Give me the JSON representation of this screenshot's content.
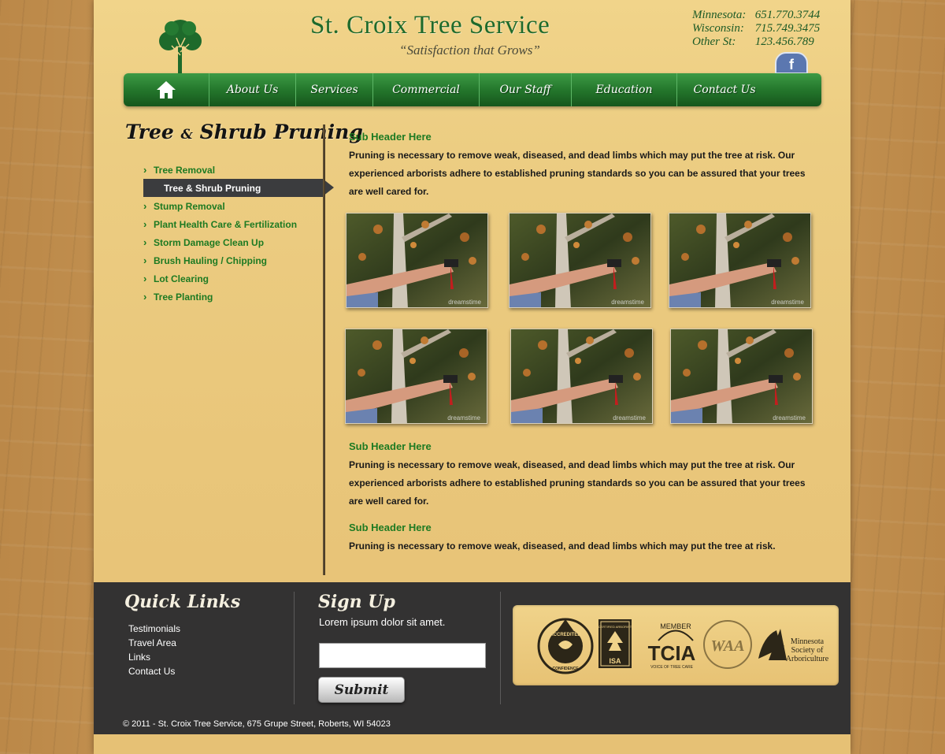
{
  "header": {
    "title": "St. Croix Tree Service",
    "tagline": "“Satisfaction that Grows”",
    "phones": [
      {
        "label": "Minnesota:",
        "number": "651.770.3744"
      },
      {
        "label": "Wisconsin:",
        "number": "715.749.3475"
      },
      {
        "label": "Other St:",
        "number": "123.456.789"
      }
    ]
  },
  "nav": {
    "items": [
      "About Us",
      "Services",
      "Commercial",
      "Our Staff",
      "Education",
      "Contact Us"
    ]
  },
  "sidebar": {
    "heading_a": "Tree",
    "heading_amp": "&",
    "heading_b": "Shrub Pruning",
    "items": [
      "Tree Removal",
      "Tree & Shrub Pruning",
      "Stump Removal",
      "Plant Health Care & Fertilization",
      "Storm Damage Clean Up",
      "Brush Hauling / Chipping",
      "Lot Clearing",
      "Tree Planting"
    ],
    "active_index": 1
  },
  "content": {
    "sections": [
      {
        "subheader": "Sub Header Here",
        "text": "Pruning is necessary to remove weak, diseased, and dead limbs which may put the tree at risk. Our experienced arborists adhere to established pruning standards so you can be assured that your trees are well cared for."
      },
      {
        "subheader": "Sub Header Here",
        "text": "Pruning is necessary to remove weak, diseased, and dead limbs which may put the tree at risk. Our experienced arborists adhere to established pruning standards so you can be assured that your trees are well cared for."
      },
      {
        "subheader": "Sub Header Here",
        "text": "Pruning is necessary to remove weak, diseased, and dead limbs which may put the tree at risk."
      }
    ],
    "watermark": "dreamstime"
  },
  "footer": {
    "quick_links_heading": "Quick Links",
    "quick_links": [
      "Testimonials",
      "Travel Area",
      "Links",
      "Contact Us"
    ],
    "signup_heading": "Sign Up",
    "signup_text": "Lorem ipsum dolor sit amet.",
    "signup_value": "",
    "submit_label": "Submit",
    "associations": {
      "accredited": "ACCREDITED",
      "accredited_bottom": "CONFIDENCE",
      "isa_top": "CERTIFIED ARBORIST",
      "isa": "ISA",
      "tcia_member": "MEMBER",
      "tcia": "TCIA",
      "tcia_sub": "VOICE OF TREE CARE",
      "waa": "WAA",
      "mn_line1": "Minnesota",
      "mn_line2": "Society of",
      "mn_line3": "Arboriculture"
    },
    "copyright": "© 2011 - St. Croix Tree Service, 675 Grupe Street, Roberts, WI 54023"
  },
  "colors": {
    "brand_green": "#1d7a22",
    "nav_green": "#24772c",
    "footer_bg": "#333232",
    "active_item_bg": "#3b3c3e"
  }
}
